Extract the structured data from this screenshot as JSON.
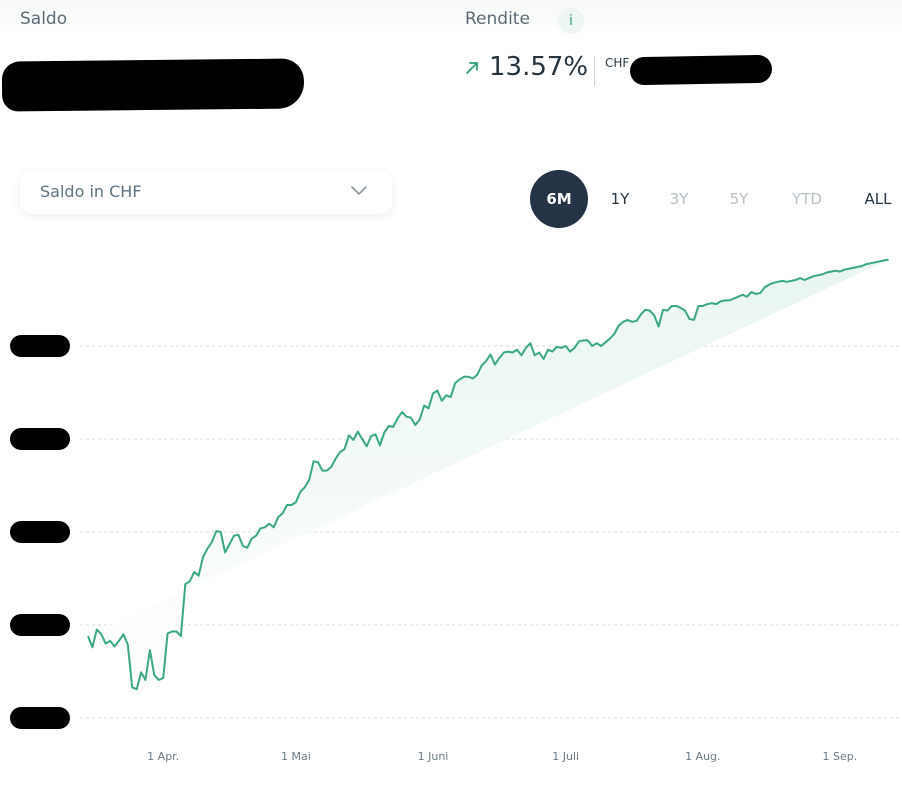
{
  "header": {
    "balance_label": "Saldo",
    "return_label": "Rendite",
    "info_symbol": "i",
    "return_value": "13.57%",
    "currency": "CHF"
  },
  "select": {
    "value": "Saldo in CHF"
  },
  "ranges": [
    {
      "label": "6M",
      "state": "active"
    },
    {
      "label": "1Y",
      "state": "enabled"
    },
    {
      "label": "3Y",
      "state": "disabled"
    },
    {
      "label": "5Y",
      "state": "disabled"
    },
    {
      "label": "YTD",
      "state": "disabled"
    },
    {
      "label": "ALL",
      "state": "enabled"
    }
  ],
  "colors": {
    "line": "#3aa882",
    "fill": "#e8f6ee",
    "active_button": "#243446",
    "accent": "#2f9d77"
  },
  "icons": [
    "info-icon",
    "arrow-up-right-icon",
    "chevron-down-icon"
  ],
  "chart_data": {
    "type": "area",
    "xlabel": "",
    "ylabel": "",
    "grid": true,
    "x_tick_labels": [
      "1 Apr.",
      "1 Mai",
      "1 Juni",
      "1 Juli",
      "1 Aug.",
      "1 Sep."
    ],
    "x_ticks_day": [
      17,
      47,
      78,
      108,
      139,
      170
    ],
    "ylim": [
      0,
      4
    ],
    "y_gridlines": [
      0,
      1,
      2,
      3,
      4
    ],
    "series": [
      {
        "x_day": [
          0,
          1,
          2,
          3,
          4,
          5,
          6,
          7,
          8,
          9,
          10,
          11,
          12,
          13,
          14,
          15,
          16,
          17,
          18,
          19,
          20,
          21,
          22,
          23,
          24,
          25,
          26,
          27,
          28,
          29,
          30,
          31,
          32,
          33,
          34,
          35,
          36,
          37,
          38,
          39,
          40,
          41,
          42,
          43,
          44,
          45,
          46,
          47,
          48,
          49,
          50,
          51,
          52,
          53,
          54,
          55,
          56,
          57,
          58,
          59,
          60,
          61,
          62,
          63,
          64,
          65,
          66,
          67,
          68,
          69,
          70,
          71,
          72,
          73,
          74,
          75,
          76,
          77,
          78,
          79,
          80,
          81,
          82,
          83,
          84,
          85,
          86,
          87,
          88,
          89,
          90,
          91,
          92,
          93,
          94,
          95,
          96,
          97,
          98,
          99,
          100,
          101,
          102,
          103,
          104,
          105,
          106,
          107,
          108,
          109,
          110,
          111,
          112,
          113,
          114,
          115,
          116,
          117,
          118,
          119,
          120,
          121,
          122,
          123,
          124,
          125,
          126,
          127,
          128,
          129,
          130,
          131,
          132,
          133,
          134,
          135,
          136,
          137,
          138,
          139,
          140,
          141,
          142,
          143,
          144,
          145,
          146,
          147,
          148,
          149,
          150,
          151,
          152,
          153,
          154,
          155,
          156,
          157,
          158,
          159,
          160,
          161,
          162,
          163,
          164,
          165,
          166,
          167,
          168,
          169,
          170,
          171,
          172,
          173,
          174,
          175,
          176,
          177,
          178,
          179,
          180,
          181,
          182
        ],
        "values": [
          0.45,
          0.33,
          0.52,
          0.47,
          0.37,
          0.4,
          0.34,
          0.4,
          0.47,
          0.36,
          -0.1,
          -0.12,
          0.06,
          -0.02,
          0.3,
          0.03,
          -0.02,
          0.0,
          0.48,
          0.5,
          0.5,
          0.45,
          1.01,
          1.04,
          1.14,
          1.1,
          1.3,
          1.39,
          1.46,
          1.58,
          1.57,
          1.35,
          1.44,
          1.53,
          1.54,
          1.42,
          1.4,
          1.5,
          1.53,
          1.61,
          1.62,
          1.66,
          1.62,
          1.73,
          1.77,
          1.86,
          1.86,
          1.89,
          2.0,
          2.05,
          2.13,
          2.33,
          2.32,
          2.23,
          2.23,
          2.27,
          2.36,
          2.43,
          2.46,
          2.61,
          2.56,
          2.65,
          2.57,
          2.49,
          2.6,
          2.62,
          2.5,
          2.64,
          2.71,
          2.7,
          2.79,
          2.86,
          2.81,
          2.8,
          2.72,
          2.78,
          2.93,
          2.9,
          3.06,
          3.09,
          2.98,
          3.04,
          3.02,
          3.17,
          3.21,
          3.24,
          3.24,
          3.22,
          3.26,
          3.36,
          3.41,
          3.48,
          3.37,
          3.44,
          3.5,
          3.51,
          3.5,
          3.53,
          3.47,
          3.55,
          3.6,
          3.47,
          3.5,
          3.43,
          3.53,
          3.51,
          3.56,
          3.55,
          3.57,
          3.51,
          3.55,
          3.62,
          3.63,
          3.63,
          3.57,
          3.6,
          3.57,
          3.61,
          3.65,
          3.7,
          3.79,
          3.83,
          3.85,
          3.83,
          3.84,
          3.91,
          3.96,
          3.95,
          3.9,
          3.78,
          3.96,
          3.95,
          4.0,
          4.0,
          3.98,
          3.95,
          3.86,
          3.85,
          4.0,
          4.0,
          4.02,
          4.03,
          4.02,
          4.05,
          4.06,
          4.06,
          4.08,
          4.1,
          4.12,
          4.1,
          4.15,
          4.13,
          4.14,
          4.2,
          4.23,
          4.25,
          4.26,
          4.27,
          4.26,
          4.27,
          4.28,
          4.3,
          4.28,
          4.3,
          4.32,
          4.33,
          4.34,
          4.36,
          4.37,
          4.38,
          4.37,
          4.39,
          4.4,
          4.41,
          4.42,
          4.43,
          4.45,
          4.46,
          4.47,
          4.48,
          4.49,
          4.5
        ]
      }
    ]
  }
}
